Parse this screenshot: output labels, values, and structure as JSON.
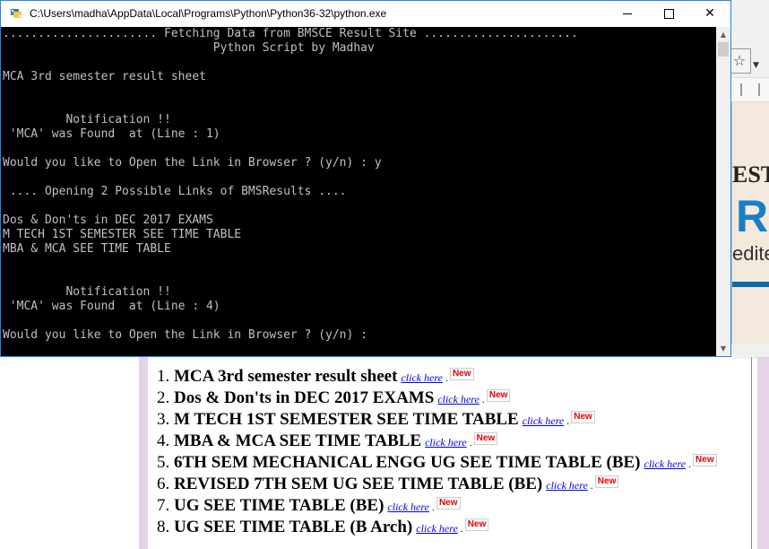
{
  "console": {
    "title": "C:\\Users\\madha\\AppData\\Local\\Programs\\Python\\Python36-32\\python.exe",
    "lines": [
      "...................... Fetching Data from BMSCE Result Site ......................",
      "                              Python Script by Madhav",
      "",
      "MCA 3rd semester result sheet",
      "",
      "",
      "         Notification !!",
      " 'MCA' was Found  at (Line : 1)",
      "",
      "Would you like to Open the Link in Browser ? (y/n) : y",
      "",
      " .... Opening 2 Possible Links of BMSResults ....",
      "",
      "Dos & Don'ts in DEC 2017 EXAMS",
      "M TECH 1ST SEMESTER SEE TIME TABLE",
      "MBA & MCA SEE TIME TABLE",
      "",
      "",
      "         Notification !!",
      " 'MCA' was Found  at (Line : 4)",
      "",
      "Would you like to Open the Link in Browser ? (y/n) :"
    ]
  },
  "window_controls": {
    "minimize": "minimize",
    "maximize": "maximize",
    "close": "✕"
  },
  "browser": {
    "banner_fragments": [
      "ESTD",
      "R",
      "edite"
    ],
    "star": "☆",
    "dropdown": "▼"
  },
  "results": [
    {
      "number": "1.",
      "title": "MCA 3rd semester result sheet",
      "link": "click here",
      "badge": "New"
    },
    {
      "number": "2.",
      "title": "Dos & Don'ts in DEC 2017 EXAMS",
      "link": "click here",
      "badge": "New"
    },
    {
      "number": "3.",
      "title": "M TECH 1ST SEMESTER SEE TIME TABLE",
      "link": "click here",
      "badge": "New"
    },
    {
      "number": "4.",
      "title": "MBA & MCA SEE TIME TABLE",
      "link": "click here",
      "badge": "New"
    },
    {
      "number": "5.",
      "title": "6TH SEM MECHANICAL ENGG UG SEE TIME TABLE (BE)",
      "link": "click here",
      "badge": "New"
    },
    {
      "number": "6.",
      "title": "REVISED 7TH SEM UG SEE TIME TABLE (BE)",
      "link": "click here",
      "badge": "New"
    },
    {
      "number": "7.",
      "title": "UG SEE TIME TABLE (BE)",
      "link": "click here",
      "badge": "New"
    },
    {
      "number": "8.",
      "title": "UG SEE TIME TABLE (B Arch)",
      "link": "click here",
      "badge": "New"
    }
  ],
  "colors": {
    "console_bg": "#000000",
    "console_text": "#c0c0c0",
    "window_border": "#1e88e5",
    "link": "#0000ee",
    "new_badge": "#e00000",
    "banner_accent": "#1a7fc4",
    "page_side": "#e4d4e6"
  }
}
